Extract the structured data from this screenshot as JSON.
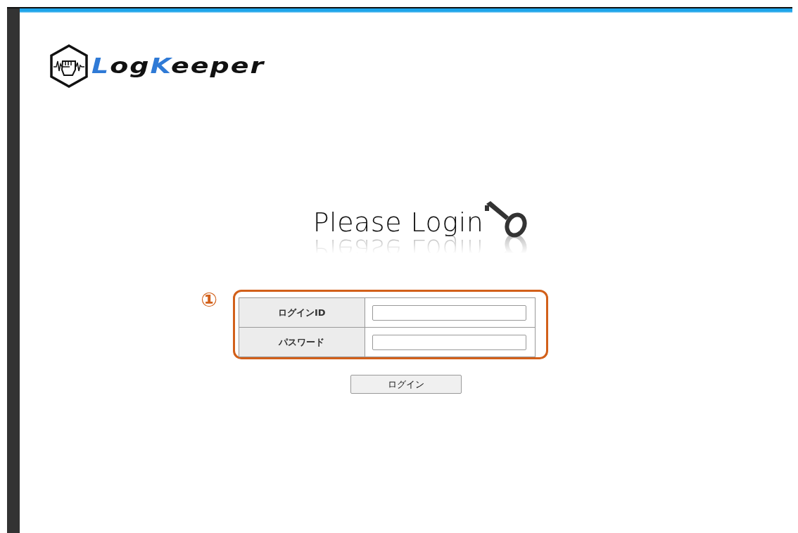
{
  "logo": {
    "parts": [
      {
        "text": "L",
        "accent": true
      },
      {
        "text": "og",
        "accent": false
      },
      {
        "text": "K",
        "accent": true
      },
      {
        "text": "eeper",
        "accent": false
      }
    ]
  },
  "heading": "Please Login",
  "annotation": {
    "label": "①"
  },
  "form": {
    "rows": [
      {
        "label": "ログインID",
        "value": ""
      },
      {
        "label": "パスワード",
        "value": ""
      }
    ]
  },
  "submit": "ログイン"
}
